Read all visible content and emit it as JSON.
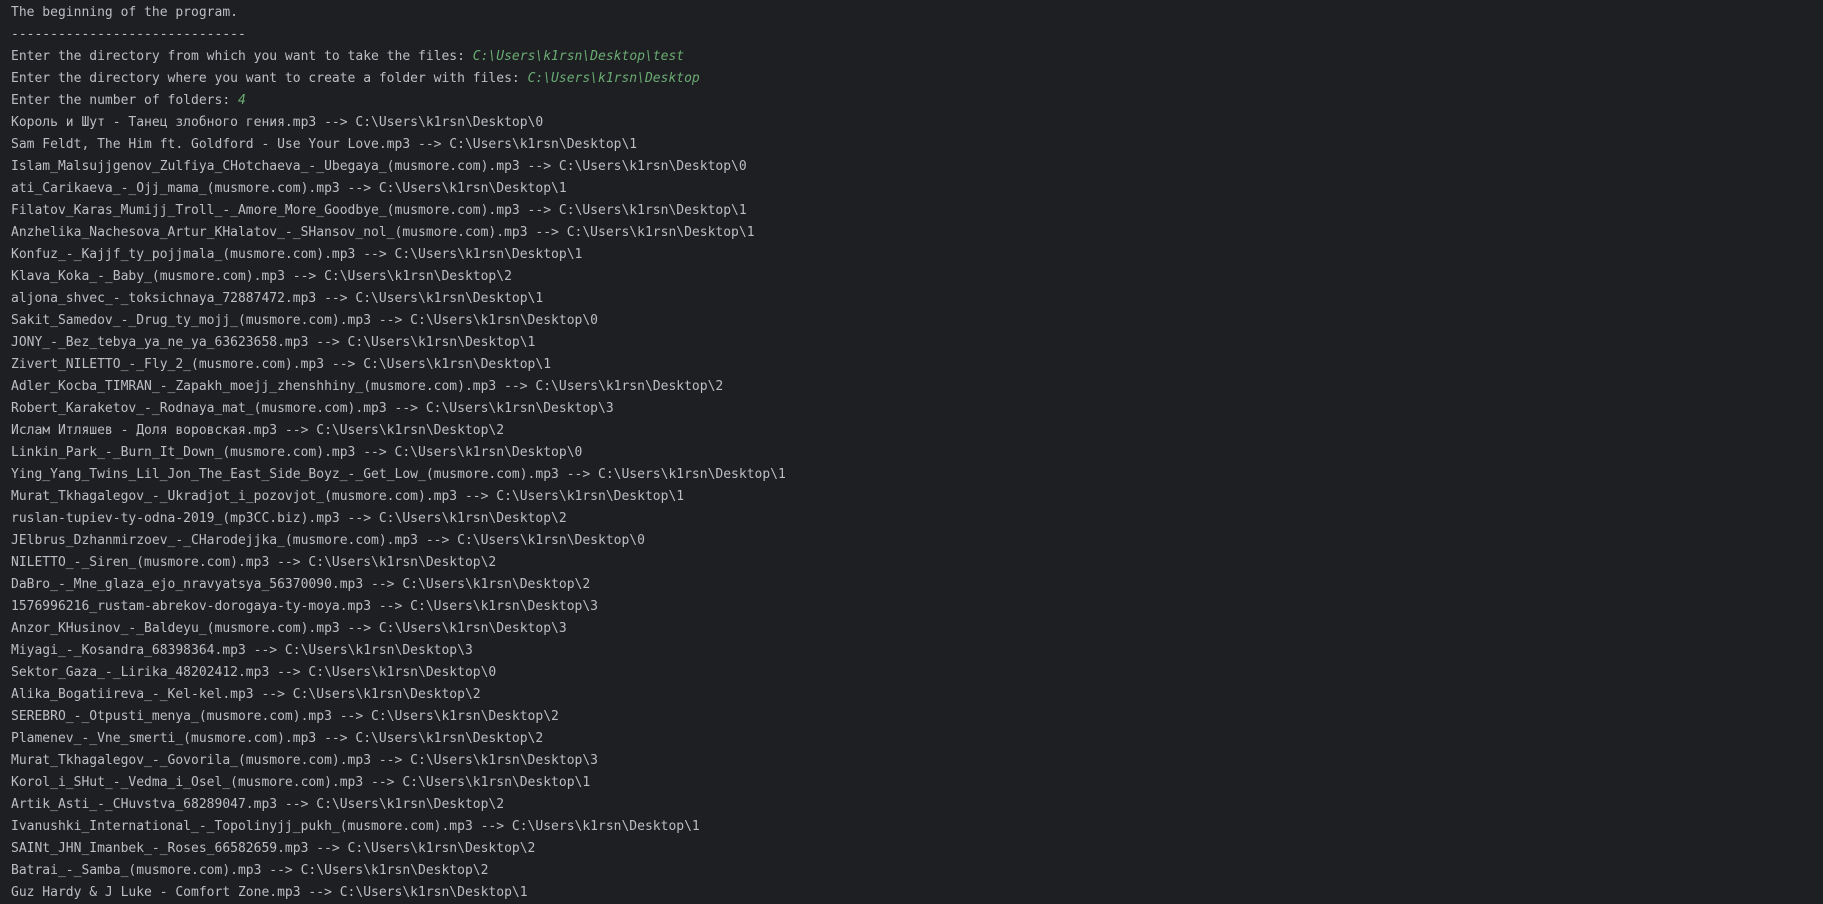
{
  "console": {
    "header": "The beginning of the program.",
    "separator": "------------------------------",
    "prompts": [
      {
        "label": "Enter the directory from which you want to take the files: ",
        "value": "C:\\Users\\k1rsn\\Desktop\\test"
      },
      {
        "label": "Enter the directory where you want to create a folder with files: ",
        "value": "C:\\Users\\k1rsn\\Desktop"
      },
      {
        "label": "Enter the number of folders: ",
        "value": "4"
      }
    ],
    "lines": [
      "Король и Шут - Танец злобного гения.mp3 --> C:\\Users\\k1rsn\\Desktop\\0",
      "Sam Feldt, The Him ft. Goldford - Use Your Love.mp3 --> C:\\Users\\k1rsn\\Desktop\\1",
      "Islam_Malsujjgenov_Zulfiya_CHotchaeva_-_Ubegaya_(musmore.com).mp3 --> C:\\Users\\k1rsn\\Desktop\\0",
      "ati_Carikaeva_-_Ojj_mama_(musmore.com).mp3 --> C:\\Users\\k1rsn\\Desktop\\1",
      "Filatov_Karas_Mumijj_Troll_-_Amore_More_Goodbye_(musmore.com).mp3 --> C:\\Users\\k1rsn\\Desktop\\1",
      "Anzhelika_Nachesova_Artur_KHalatov_-_SHansov_nol_(musmore.com).mp3 --> C:\\Users\\k1rsn\\Desktop\\1",
      "Konfuz_-_Kajjf_ty_pojjmala_(musmore.com).mp3 --> C:\\Users\\k1rsn\\Desktop\\1",
      "Klava_Koka_-_Baby_(musmore.com).mp3 --> C:\\Users\\k1rsn\\Desktop\\2",
      "aljona_shvec_-_toksichnaya_72887472.mp3 --> C:\\Users\\k1rsn\\Desktop\\1",
      "Sakit_Samedov_-_Drug_ty_mojj_(musmore.com).mp3 --> C:\\Users\\k1rsn\\Desktop\\0",
      "JONY_-_Bez_tebya_ya_ne_ya_63623658.mp3 --> C:\\Users\\k1rsn\\Desktop\\1",
      "Zivert_NILETTO_-_Fly_2_(musmore.com).mp3 --> C:\\Users\\k1rsn\\Desktop\\1",
      "Adler_Kocba_TIMRAN_-_Zapakh_moejj_zhenshhiny_(musmore.com).mp3 --> C:\\Users\\k1rsn\\Desktop\\2",
      "Robert_Karaketov_-_Rodnaya_mat_(musmore.com).mp3 --> C:\\Users\\k1rsn\\Desktop\\3",
      "Ислам Итляшев - Доля воровская.mp3 --> C:\\Users\\k1rsn\\Desktop\\2",
      "Linkin_Park_-_Burn_It_Down_(musmore.com).mp3 --> C:\\Users\\k1rsn\\Desktop\\0",
      "Ying_Yang_Twins_Lil_Jon_The_East_Side_Boyz_-_Get_Low_(musmore.com).mp3 --> C:\\Users\\k1rsn\\Desktop\\1",
      "Murat_Tkhagalegov_-_Ukradjot_i_pozovjot_(musmore.com).mp3 --> C:\\Users\\k1rsn\\Desktop\\1",
      "ruslan-tupiev-ty-odna-2019_(mp3CC.biz).mp3 --> C:\\Users\\k1rsn\\Desktop\\2",
      "JElbrus_Dzhanmirzoev_-_CHarodejjka_(musmore.com).mp3 --> C:\\Users\\k1rsn\\Desktop\\0",
      "NILETTO_-_Siren_(musmore.com).mp3 --> C:\\Users\\k1rsn\\Desktop\\2",
      "DaBro_-_Mne_glaza_ejo_nravyatsya_56370090.mp3 --> C:\\Users\\k1rsn\\Desktop\\2",
      "1576996216_rustam-abrekov-dorogaya-ty-moya.mp3 --> C:\\Users\\k1rsn\\Desktop\\3",
      "Anzor_KHusinov_-_Baldeyu_(musmore.com).mp3 --> C:\\Users\\k1rsn\\Desktop\\3",
      "Miyagi_-_Kosandra_68398364.mp3 --> C:\\Users\\k1rsn\\Desktop\\3",
      "Sektor_Gaza_-_Lirika_48202412.mp3 --> C:\\Users\\k1rsn\\Desktop\\0",
      "Alika_Bogatiireva_-_Kel-kel.mp3 --> C:\\Users\\k1rsn\\Desktop\\2",
      "SEREBRO_-_Otpusti_menya_(musmore.com).mp3 --> C:\\Users\\k1rsn\\Desktop\\2",
      "Plamenev_-_Vne_smerti_(musmore.com).mp3 --> C:\\Users\\k1rsn\\Desktop\\2",
      "Murat_Tkhagalegov_-_Govorila_(musmore.com).mp3 --> C:\\Users\\k1rsn\\Desktop\\3",
      "Korol_i_SHut_-_Vedma_i_Osel_(musmore.com).mp3 --> C:\\Users\\k1rsn\\Desktop\\1",
      "Artik_Asti_-_CHuvstva_68289047.mp3 --> C:\\Users\\k1rsn\\Desktop\\2",
      "Ivanushki_International_-_Topolinyjj_pukh_(musmore.com).mp3 --> C:\\Users\\k1rsn\\Desktop\\1",
      "SAINt_JHN_Imanbek_-_Roses_66582659.mp3 --> C:\\Users\\k1rsn\\Desktop\\2",
      "Batrai_-_Samba_(musmore.com).mp3 --> C:\\Users\\k1rsn\\Desktop\\2",
      "Guz Hardy & J Luke - Comfort Zone.mp3 --> C:\\Users\\k1rsn\\Desktop\\1"
    ]
  },
  "colors": {
    "background": "#1e1f22",
    "text": "#bcbec4",
    "user_input": "#6aab73"
  }
}
